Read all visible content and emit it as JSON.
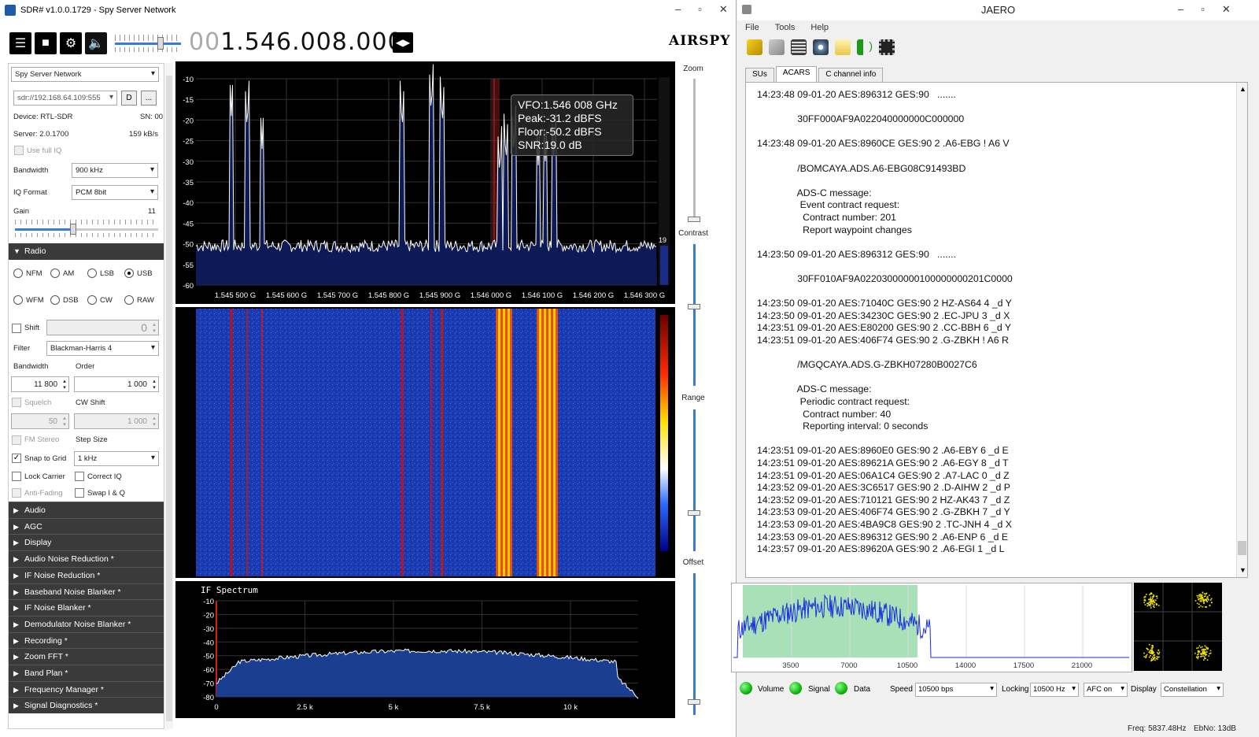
{
  "sdr": {
    "title": "SDR# v1.0.0.1729 - Spy Server Network",
    "freq_dim": "00",
    "freq_main": "1.546.008.000",
    "brand": "AIRSPY",
    "source": "Spy Server Network",
    "uri": "sdr://192.168.64.109:555",
    "connect_btn": "D",
    "more_btn": "...",
    "device_label": "Device: RTL-SDR",
    "sn_label": "SN: 00",
    "server_label": "Server: 2.0.1700",
    "rate_label": "159 kB/s",
    "use_full_iq": "Use full IQ",
    "bandwidth_label": "Bandwidth",
    "bandwidth_value": "900 kHz",
    "iqformat_label": "IQ Format",
    "iqformat_value": "PCM 8bit",
    "gain_label": "Gain",
    "gain_value": "11",
    "radio_section": "Radio",
    "modes_row1": [
      "NFM",
      "AM",
      "LSB",
      "USB"
    ],
    "modes_row2": [
      "WFM",
      "DSB",
      "CW",
      "RAW"
    ],
    "shift_label": "Shift",
    "shift_value": "0",
    "filter_label": "Filter",
    "filter_value": "Blackman-Harris 4",
    "bw_label": "Bandwidth",
    "order_label": "Order",
    "bw_value": "11 800",
    "order_value": "1 000",
    "squelch_label": "Squelch",
    "cwshift_label": "CW Shift",
    "squelch_value": "50",
    "cwshift_value": "1 000",
    "fmstereo_label": "FM Stereo",
    "stepsize_label": "Step Size",
    "snap_label": "Snap to Grid",
    "step_value": "1 kHz",
    "lockcarrier_label": "Lock Carrier",
    "correctiq_label": "Correct IQ",
    "antifading_label": "Anti-Fading",
    "swapiq_label": "Swap I & Q",
    "sections": [
      "Audio",
      "AGC",
      "Display",
      "Audio Noise Reduction *",
      "IF Noise Reduction *",
      "Baseband Noise Blanker *",
      "IF Noise Blanker *",
      "Demodulator Noise Blanker *",
      "Recording *",
      "Zoom FFT *",
      "Band Plan *",
      "Frequency Manager *",
      "Signal Diagnostics *"
    ],
    "tooltip": [
      "VFO:1.546 008 GHz",
      "Peak:-31.2 dBFS",
      "Floor:-50.2 dBFS",
      "SNR:19.0 dB"
    ],
    "spectrum_yticks": [
      "-10",
      "-15",
      "-20",
      "-25",
      "-30",
      "-35",
      "-40",
      "-45",
      "-50",
      "-55",
      "-60"
    ],
    "spectrum_xticks": [
      "1.545 500 G",
      "1.545 600 G",
      "1.545 700 G",
      "1.545 800 G",
      "1.545 900 G",
      "1.546 000 G",
      "1.546 100 G",
      "1.546 200 G",
      "1.546 300 G"
    ],
    "snr_indicator": "19",
    "zoom_label": "Zoom",
    "contrast_label": "Contrast",
    "range_label": "Range",
    "offset_label": "Offset",
    "if_title": "IF Spectrum",
    "if_yticks": [
      "-10",
      "-20",
      "-30",
      "-40",
      "-50",
      "-60",
      "-70",
      "-80"
    ],
    "if_xticks": [
      "0",
      "2.5 k",
      "5 k",
      "7.5 k",
      "10 k"
    ]
  },
  "jaero": {
    "title": "JAERO",
    "menu": [
      "File",
      "Tools",
      "Help"
    ],
    "tabs": [
      "SUs",
      "ACARS",
      "C channel info"
    ],
    "active_tab": "ACARS",
    "log": [
      "14:23:48 09-01-20 AES:896312 GES:90   .......",
      "",
      "               30FF000AF9A022040000000C000000",
      "",
      "14:23:48 09-01-20 AES:8960CE GES:90 2 .A6-EBG ! A6 V",
      "",
      "               /BOMCAYA.ADS.A6-EBG08C91493BD",
      "",
      "               ADS-C message:",
      "                Event contract request:",
      "                 Contract number: 201",
      "                 Report waypoint changes",
      "",
      "14:23:50 09-01-20 AES:896312 GES:90   .......",
      "",
      "               30FF010AF9A02203000000100000000201C0000",
      "",
      "14:23:50 09-01-20 AES:71040C GES:90 2 HZ-AS64 4 _d Y",
      "14:23:50 09-01-20 AES:34230C GES:90 2 .EC-JPU 3 _d X",
      "14:23:51 09-01-20 AES:E80200 GES:90 2 .CC-BBH 6 _d Y",
      "14:23:51 09-01-20 AES:406F74 GES:90 2 .G-ZBKH ! A6 R",
      "",
      "               /MGQCAYA.ADS.G-ZBKH07280B0027C6",
      "",
      "               ADS-C message:",
      "                Periodic contract request:",
      "                 Contract number: 40",
      "                 Reporting interval: 0 seconds",
      "",
      "14:23:51 09-01-20 AES:8960E0 GES:90 2 .A6-EBY 6 _d E",
      "14:23:51 09-01-20 AES:89621A GES:90 2 .A6-EGY 8 _d T",
      "14:23:51 09-01-20 AES:06A1C4 GES:90 2 .A7-LAC 0 _d Z",
      "14:23:52 09-01-20 AES:3C6517 GES:90 2 .D-AIHW 2 _d P",
      "14:23:52 09-01-20 AES:710121 GES:90 2 HZ-AK43 7 _d Z",
      "14:23:53 09-01-20 AES:406F74 GES:90 2 .G-ZBKH 7 _d Y",
      "14:23:53 09-01-20 AES:4BA9C8 GES:90 2 .TC-JNH 4 _d X",
      "14:23:53 09-01-20 AES:896312 GES:90 2 .A6-ENP 6 _d E",
      "14:23:57 09-01-20 AES:89620A GES:90 2 .A6-EGI 1 _d L"
    ],
    "spectrum_xticks": [
      "3500",
      "7000",
      "10500",
      "14000",
      "17500",
      "21000"
    ],
    "led_volume": "Volume",
    "led_signal": "Signal",
    "led_data": "Data",
    "speed_label": "Speed",
    "speed_value": "10500 bps",
    "locking_label": "Locking",
    "locking_value": "10500 Hz",
    "afc_value": "AFC on",
    "display_label": "Display",
    "display_value": "Constellation",
    "status_freq": "Freq: 5837.48Hz",
    "status_ebno": "EbNo: 13dB"
  }
}
